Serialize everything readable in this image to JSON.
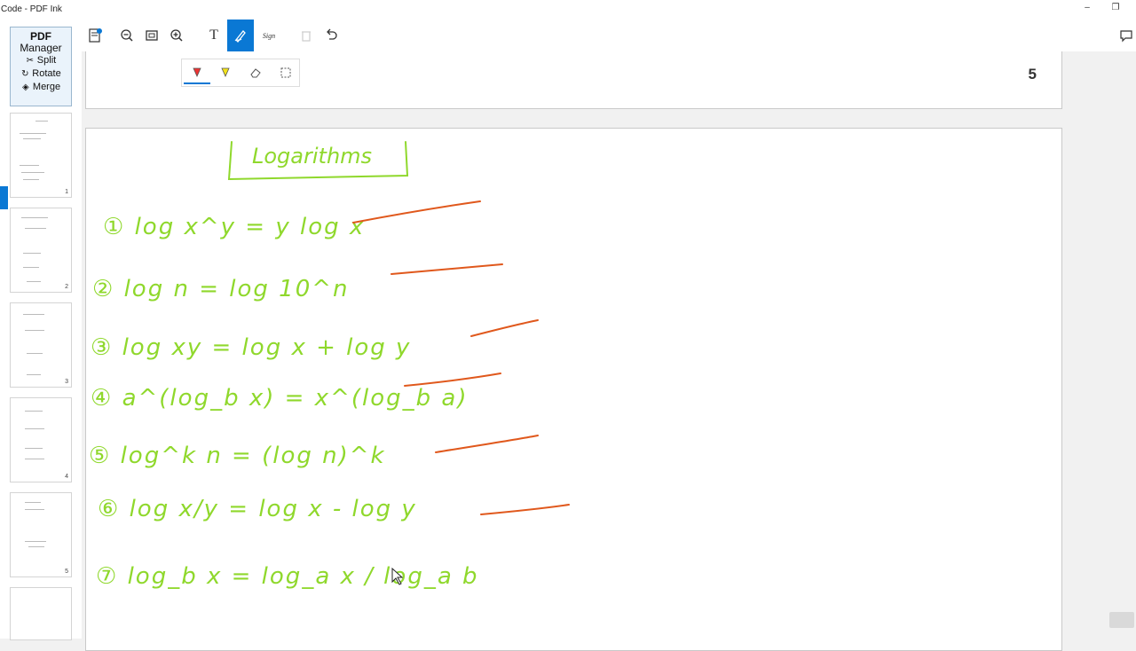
{
  "window": {
    "title": "Code - PDF Ink",
    "minimize": "‒",
    "restore": "❐"
  },
  "sidebar": {
    "pdf_manager": {
      "title": "PDF",
      "subtitle": "Manager",
      "split": "Split",
      "rotate": "Rotate",
      "merge": "Merge"
    },
    "thumbnails": [
      "1",
      "2",
      "3",
      "4",
      "5"
    ]
  },
  "toolbar": {
    "text_tool": "T",
    "sign_tool": "Sign"
  },
  "page": {
    "number": "5"
  },
  "notes": {
    "heading": "Logarithms",
    "formulas": [
      "① log x^y = y log x",
      "② log n = log 10^n",
      "③ log xy = log x + log y",
      "④ a^(log_b x) = x^(log_b a)",
      "⑤ log^k n = (log n)^k",
      "⑥ log x/y = log x - log y",
      "⑦ log_b x = log_a x / log_a b"
    ]
  },
  "colors": {
    "ink_green": "#8fd82c",
    "ink_red": "#e0581c",
    "accent": "#0a78d4"
  },
  "icons": [
    "document-icon",
    "zoom-out-icon",
    "fit-page-icon",
    "zoom-in-icon",
    "text-icon",
    "pen-icon",
    "sign-icon",
    "delete-icon",
    "undo-icon",
    "comment-icon",
    "red-pen-icon",
    "highlighter-icon",
    "eraser-icon",
    "lasso-select-icon"
  ]
}
